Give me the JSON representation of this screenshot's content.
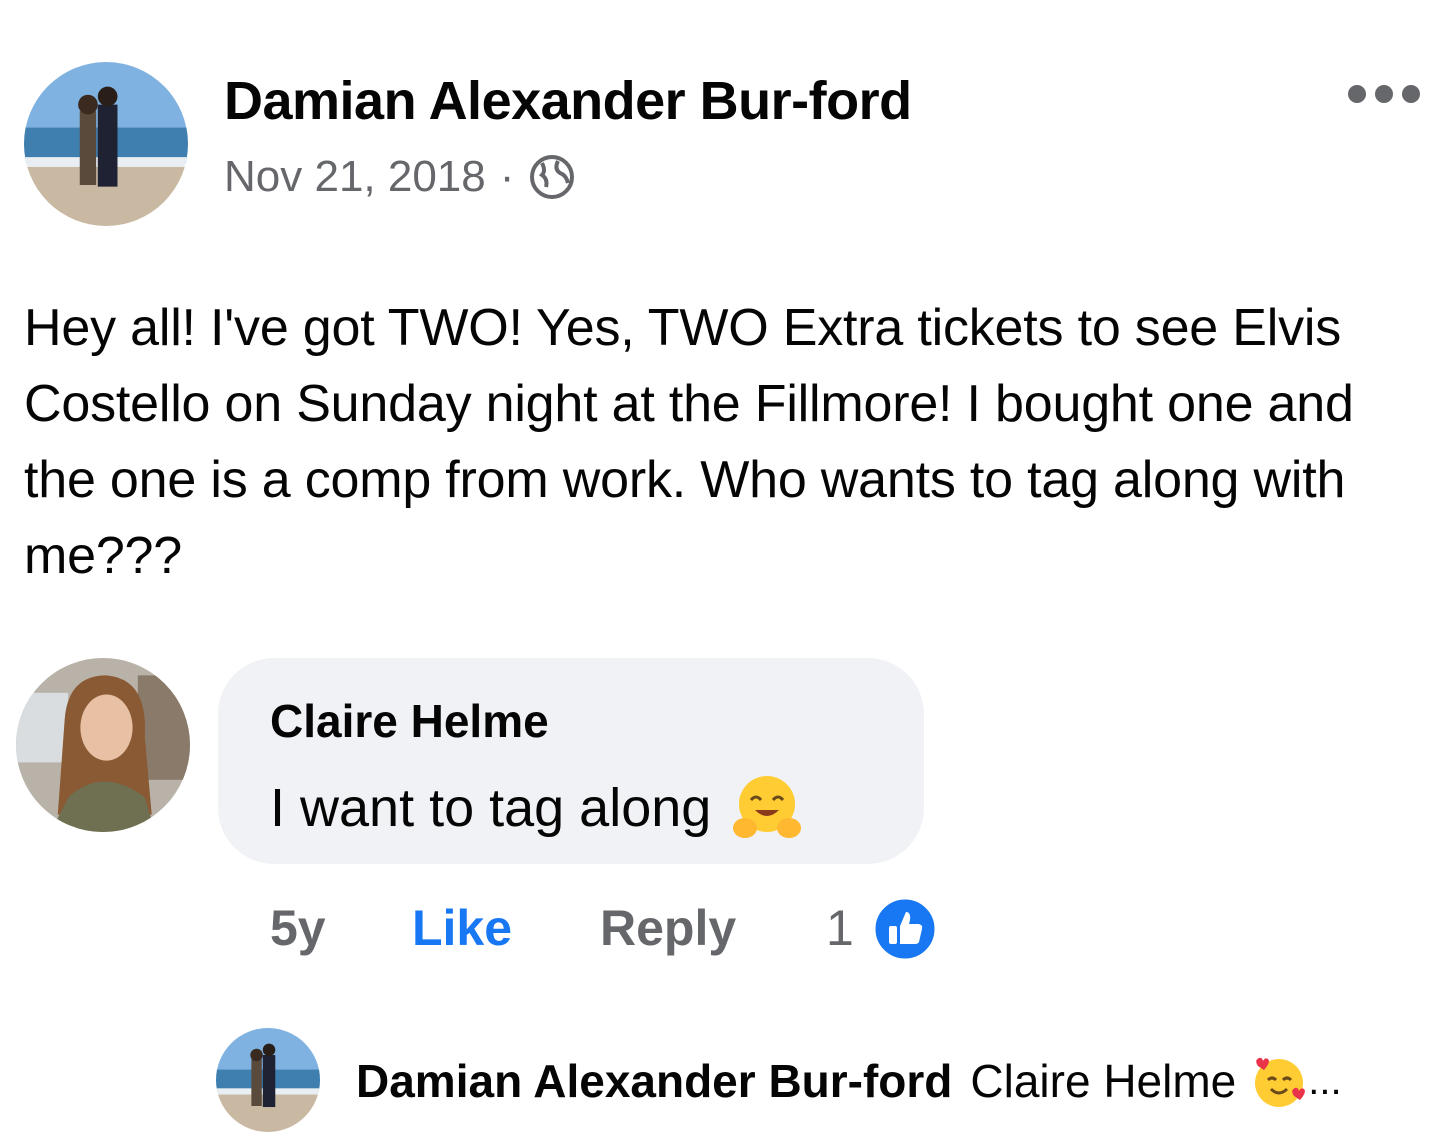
{
  "post": {
    "author": "Damian Alexander Bur-ford",
    "date": "Nov 21, 2018",
    "separator": "·",
    "privacy_icon": "globe-icon",
    "more_icon": "more-options-icon",
    "body": "Hey all! I've got TWO! Yes, TWO Extra tickets to see Elvis Costello on Sunday night at the Fillmore! I bought one and the one is a comp from work. Who wants to tag along with me???"
  },
  "comment": {
    "author": "Claire Helme",
    "text": "I want to tag along",
    "emoji": "hugging-face-emoji",
    "time": "5y",
    "like_label": "Like",
    "reply_label": "Reply",
    "reaction_count": "1",
    "reaction_icon": "like-reaction-icon"
  },
  "reply": {
    "author": "Damian Alexander Bur-ford",
    "preview": "Claire Helme",
    "emoji": "smiling-face-with-hearts-emoji",
    "ellipsis": "..."
  },
  "colors": {
    "accent": "#1877f2",
    "secondary_text": "#65676b",
    "bubble_bg": "#f0f2f5"
  }
}
